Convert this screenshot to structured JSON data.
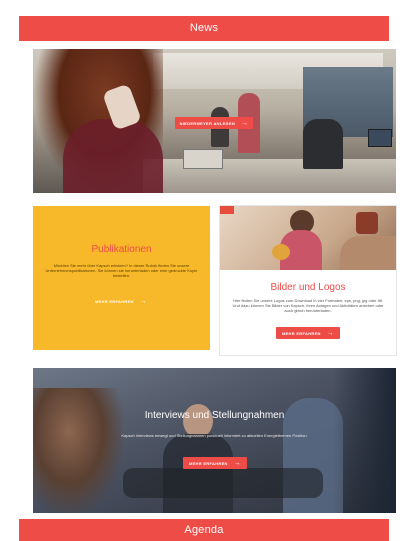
{
  "news": {
    "label": "News"
  },
  "hero": {
    "cta_label": "NIEDERMEYER ANLEGEN"
  },
  "publikationen": {
    "title": "Publikationen",
    "body": "Möchten Sie mehr über Kapsch erfahren? In dieser Rubrik finden Sie unsere Unternehmenspublikationen. Sie können sie herunterladen oder eine gedruckte Kopie bestellen.",
    "cta_label": "MEHR ERFAHREN"
  },
  "logos": {
    "title": "Bilder und Logos",
    "body": "Hier finden Sie unsere Logos zum Download in vier Formaten: eps, png, jpg oder tiff. Und dazu können Sie Bilder von Kapsch, ihren Anlagen und Aktivitäten ansehen oder auch gleich herunterladen.",
    "cta_label": "MEHR ERFAHREN"
  },
  "interviews": {
    "title": "Interviews und Stellungnahmen",
    "body": "Kapsch Interviews bewegt und Stellungnahmen punktuell informiert zu aktuellen Energiethemen Position.",
    "cta_label": "MEHR ERFAHREN"
  },
  "agenda": {
    "label": "Agenda"
  },
  "colors": {
    "accent": "#ee4c47",
    "publikationen_bg": "#f7b82a"
  }
}
